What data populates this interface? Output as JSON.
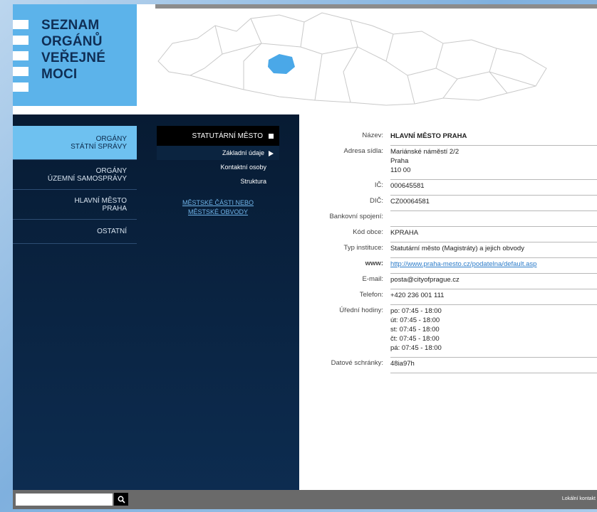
{
  "logo": {
    "lines": [
      "SEZNAM",
      "ORGÁNŮ",
      "VEŘEJNÉ",
      "MOCI"
    ]
  },
  "nav_primary": [
    {
      "line1": "ORGÁNY",
      "line2": "STÁTNÍ SPRÁVY"
    },
    {
      "line1": "ORGÁNY",
      "line2": "ÚZEMNÍ SAMOSPRÁVY"
    },
    {
      "line1": "HLAVNÍ MĚSTO",
      "line2": "PRAHA"
    },
    {
      "line1": "OSTATNÍ",
      "line2": ""
    }
  ],
  "nav_secondary": {
    "head": "STATUTÁRNÍ MĚSTO",
    "items": [
      "Základní údaje",
      "Kontaktní osoby",
      "Struktura"
    ],
    "link_line1": "MĚSTSKÉ ČÁSTI NEBO",
    "link_line2": "MĚSTSKÉ OBVODY"
  },
  "details": {
    "nazev": {
      "label": "Název:",
      "value": "HLAVNÍ MĚSTO PRAHA"
    },
    "adresa": {
      "label": "Adresa sídla:",
      "line1": "Mariánské náměstí 2/2",
      "line2": "Praha",
      "line3": "110 00"
    },
    "ic": {
      "label": "IČ:",
      "value": "000645581"
    },
    "dic": {
      "label": "DIČ:",
      "value": "CZ00064581"
    },
    "banka": {
      "label": "Bankovní spojení:",
      "value": ""
    },
    "kod": {
      "label": "Kód obce:",
      "value": "KPRAHA"
    },
    "typ": {
      "label": "Typ instituce:",
      "value": "Statutární město (Magistráty) a jejich obvody"
    },
    "www": {
      "label": "www:",
      "value": "http://www.praha-mesto.cz/podatelna/default.asp"
    },
    "email": {
      "label": "E-mail:",
      "value": "posta@cityofprague.cz"
    },
    "telefon": {
      "label": "Telefon:",
      "value": "+420 236 001 111"
    },
    "hodiny": {
      "label": "Úřední hodiny:",
      "lines": [
        "po: 07:45 - 18:00",
        "út: 07:45 - 18:00",
        "st: 07:45 - 18:00",
        "čt: 07:45 - 18:00",
        "pá: 07:45 - 18:00"
      ]
    },
    "schranky": {
      "label": "Datové schránky:",
      "value": "48ia97h"
    }
  },
  "footer": {
    "search_placeholder": "",
    "note": "Lokální kontakt"
  },
  "colors": {
    "accent": "#5cb3ea",
    "map_highlight": "#4aa8e8",
    "dark_bg": "#0d2c50"
  }
}
